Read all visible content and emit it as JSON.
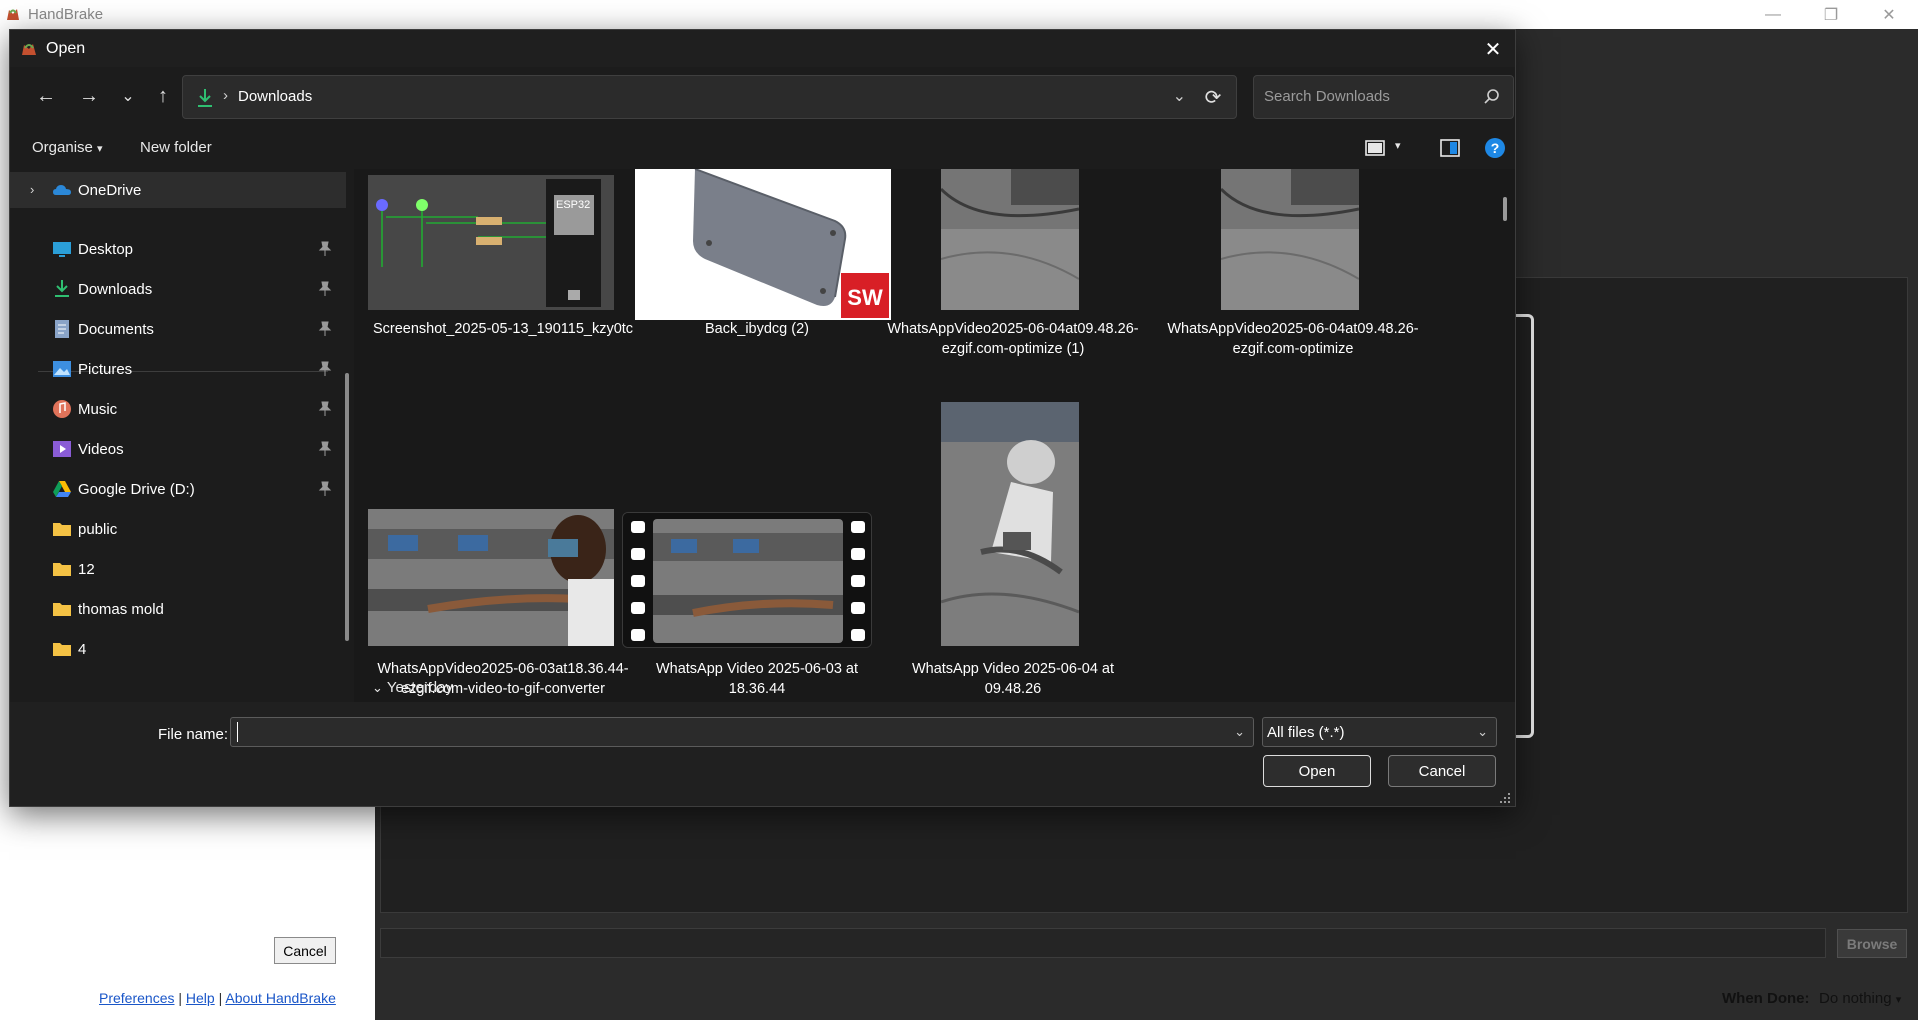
{
  "app": {
    "title": "HandBrake",
    "window_controls": {
      "minimize": "—",
      "restore": "❐",
      "close": "✕"
    },
    "left_panel": {
      "cancel_label": "Cancel",
      "links": {
        "preferences": "Preferences",
        "sep1": "|",
        "help": "Help",
        "sep2": "|",
        "about": "About HandBrake"
      }
    },
    "right_panel": {
      "browse_label": "Browse",
      "when_done_label": "When Done:",
      "when_done_value": "Do nothing"
    }
  },
  "dialog": {
    "title": "Open",
    "close_glyph": "✕",
    "nav": {
      "back": "←",
      "forward": "→",
      "recent": "⌄",
      "up": "↑",
      "breadcrumb_sep": "›",
      "location": "Downloads",
      "address_dropdown": "⌄",
      "refresh": "⟳"
    },
    "search": {
      "placeholder": "Search Downloads"
    },
    "toolbar": {
      "organise": "Organise",
      "organise_chevron": "▾",
      "new_folder": "New folder",
      "view_chevron": "▾"
    },
    "sidebar": {
      "onedrive": {
        "label": "OneDrive",
        "expander": "›"
      },
      "items": [
        {
          "label": "Desktop",
          "icon": "desktop-icon",
          "pinned": true
        },
        {
          "label": "Downloads",
          "icon": "downloads-icon",
          "pinned": true
        },
        {
          "label": "Documents",
          "icon": "documents-icon",
          "pinned": true
        },
        {
          "label": "Pictures",
          "icon": "pictures-icon",
          "pinned": true
        },
        {
          "label": "Music",
          "icon": "music-icon",
          "pinned": true
        },
        {
          "label": "Videos",
          "icon": "videos-icon",
          "pinned": true
        },
        {
          "label": "Google Drive (D:)",
          "icon": "google-drive-icon",
          "pinned": true
        },
        {
          "label": "public",
          "icon": "folder-icon",
          "pinned": false
        },
        {
          "label": "12",
          "icon": "folder-icon",
          "pinned": false
        },
        {
          "label": "thomas mold",
          "icon": "folder-icon",
          "pinned": false
        },
        {
          "label": "4",
          "icon": "folder-icon",
          "pinned": false
        }
      ]
    },
    "files": [
      {
        "caption_1": "Screenshot_2025-05-13_190115_kzy0tc",
        "caption_2": "",
        "kind": "circuit-image"
      },
      {
        "caption_1": "Back_ibydcg (2)",
        "caption_2": "",
        "kind": "cad-image",
        "badge": "SW"
      },
      {
        "caption_1": "WhatsAppVideo2025-06-04at09.48.26-",
        "caption_2": "ezgif.com-optimize (1)",
        "kind": "gif"
      },
      {
        "caption_1": "WhatsAppVideo2025-06-04at09.48.26-",
        "caption_2": "ezgif.com-optimize",
        "kind": "gif"
      },
      {
        "caption_1": "WhatsAppVideo2025-06-03at18.36.44-",
        "caption_2": "ezgif.com-video-to-gif-converter",
        "kind": "gif"
      },
      {
        "caption_1": "WhatsApp Video 2025-06-03 at",
        "caption_2": "18.36.44",
        "kind": "video"
      },
      {
        "caption_1": "WhatsApp Video 2025-06-04 at",
        "caption_2": "09.48.26",
        "kind": "video"
      }
    ],
    "group_header": {
      "expander": "⌄",
      "label": "Yesterday"
    },
    "bottom": {
      "file_name_label": "File name:",
      "file_name_value": "",
      "file_name_chevron": "⌄",
      "filter_value": "All files (*.*)",
      "filter_chevron": "⌄",
      "open_label": "Open",
      "cancel_label": "Cancel"
    }
  },
  "colors": {
    "dialog_bg": "#1f1f1f",
    "content_bg": "#191919",
    "accent": "#1e88e5",
    "folder": "#f4c244",
    "download_green": "#2fbf71"
  }
}
